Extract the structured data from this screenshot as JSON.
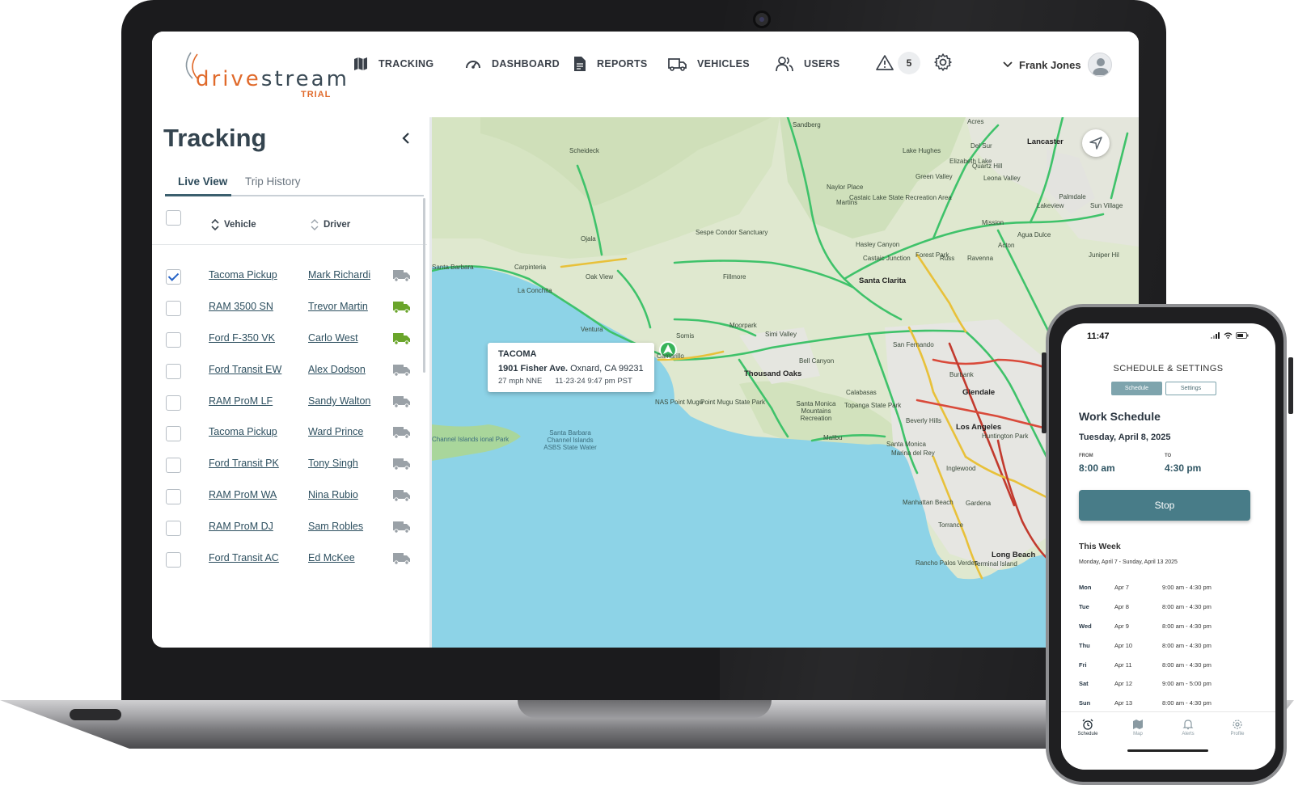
{
  "brand": {
    "word_part1": "drive",
    "word_part2": "stream",
    "trial_label": "TRIAL",
    "accent_color": "#e06a2b"
  },
  "nav": {
    "items": [
      {
        "label": "TRACKING",
        "icon": "map-icon"
      },
      {
        "label": "DASHBOARD",
        "icon": "gauge-icon"
      },
      {
        "label": "REPORTS",
        "icon": "document-icon"
      },
      {
        "label": "VEHICLES",
        "icon": "truck-icon"
      },
      {
        "label": "USERS",
        "icon": "users-icon"
      }
    ],
    "alert_count": "5",
    "user_name": "Frank Jones"
  },
  "sidebar": {
    "title": "Tracking",
    "tabs": [
      "Live View",
      "Trip History"
    ],
    "columns": {
      "vehicle": "Vehicle",
      "driver": "Driver"
    },
    "rows": [
      {
        "vehicle": "Tacoma Pickup",
        "driver": "Mark Richardi",
        "checked": true,
        "status_color": "#9aa1a7"
      },
      {
        "vehicle": "RAM 3500 SN",
        "driver": "Trevor Martin",
        "checked": false,
        "status_color": "#6aa52b"
      },
      {
        "vehicle": "Ford F-350 VK",
        "driver": "Carlo West",
        "checked": false,
        "status_color": "#6aa52b"
      },
      {
        "vehicle": "Ford Transit EW",
        "driver": "Alex Dodson",
        "checked": false,
        "status_color": "#9aa1a7"
      },
      {
        "vehicle": "RAM ProM LF",
        "driver": "Sandy Walton",
        "checked": false,
        "status_color": "#9aa1a7"
      },
      {
        "vehicle": "Tacoma Pickup",
        "driver": "Ward Prince",
        "checked": false,
        "status_color": "#9aa1a7"
      },
      {
        "vehicle": "Ford Transit PK",
        "driver": "Tony Singh",
        "checked": false,
        "status_color": "#9aa1a7"
      },
      {
        "vehicle": "RAM ProM WA",
        "driver": "Nina Rubio",
        "checked": false,
        "status_color": "#9aa1a7"
      },
      {
        "vehicle": "RAM ProM DJ",
        "driver": "Sam Robles",
        "checked": false,
        "status_color": "#9aa1a7"
      },
      {
        "vehicle": "Ford Transit AC",
        "driver": "Ed McKee",
        "checked": false,
        "status_color": "#9aa1a7"
      }
    ]
  },
  "map": {
    "popup": {
      "title": "TACOMA",
      "street": "1901 Fisher Ave.",
      "city": "Oxnard, CA 99231",
      "speed": "27 mph NNE",
      "time": "11·23·24 9:47 pm PST"
    },
    "labels": [
      "Sandberg",
      "Acres",
      "Lancaster",
      "Scheideck",
      "Lake Hughes",
      "Del Sur",
      "Elizabeth Lake",
      "Quartz Hill",
      "Green Valley",
      "Leona Valley",
      "Naylor Place",
      "Palmdale",
      "Castaic Lake State Recreation Area",
      "Martins",
      "Lakeview",
      "Sun Village",
      "Sespe Condor Sanctuary",
      "Mission",
      "Agua Dulce",
      "Acton",
      "Ojala",
      "Hasley Canyon",
      "Castaic Junction",
      "Forest Park",
      "Russ",
      "Ravenna",
      "Juniper Hil",
      "Santa Barbara",
      "Carpinteria",
      "Oak View",
      "Fillmore",
      "Santa Clarita",
      "La Conchita",
      "Ventura",
      "Somis",
      "Moorpark",
      "Simi Valley",
      "Camarillo",
      "Bell Canyon",
      "Thousand Oaks",
      "Calabasas",
      "San Fernando",
      "Burbank",
      "Pasa",
      "Glendale",
      "NAS Point Mugu",
      "Point Mugu State Park",
      "Santa Monica Mountains Recreation",
      "Topanga State Park",
      "Beverly Hills",
      "Los Angeles",
      "Malibu",
      "Santa Monica",
      "Huntington Park",
      "Marina del Rey",
      "Inglewood",
      "Santa Barbara Channel Islands ASBS State Water",
      "Channel Islands ional Park",
      "Manhattan Beach",
      "Gardena",
      "Torrance",
      "Rancho Palos Verdes",
      "Terminal Island",
      "Long Beach"
    ]
  },
  "phone": {
    "time": "11:47",
    "title": "SCHEDULE & SETTINGS",
    "segments": [
      "Schedule",
      "Settings"
    ],
    "heading": "Work Schedule",
    "date": "Tuesday, April 8, 2025",
    "from_label": "FROM",
    "from_value": "8:00 am",
    "to_label": "TO",
    "to_value": "4:30 pm",
    "stop_label": "Stop",
    "week_title": "This Week",
    "week_range": "Monday, April 7 - Sunday, April 13 2025",
    "schedule": [
      {
        "day": "Mon",
        "date": "Apr 7",
        "hours": "9:00 am - 4:30 pm"
      },
      {
        "day": "Tue",
        "date": "Apr 8",
        "hours": "8:00 am - 4:30 pm"
      },
      {
        "day": "Wed",
        "date": "Apr 9",
        "hours": "8:00 am - 4:30 pm"
      },
      {
        "day": "Thu",
        "date": "Apr 10",
        "hours": "8:00 am - 4:30 pm"
      },
      {
        "day": "Fri",
        "date": "Apr 11",
        "hours": "8:00 am - 4:30 pm"
      },
      {
        "day": "Sat",
        "date": "Apr 12",
        "hours": "9:00 am - 5:00 pm"
      },
      {
        "day": "Sun",
        "date": "Apr 13",
        "hours": "8:00 am - 4:30 pm"
      }
    ],
    "tabbar": [
      {
        "label": "Schedule",
        "icon": "alarm-clock-icon"
      },
      {
        "label": "Map",
        "icon": "map-icon"
      },
      {
        "label": "Alerts",
        "icon": "bell-icon"
      },
      {
        "label": "Profile",
        "icon": "gear-icon"
      }
    ]
  }
}
